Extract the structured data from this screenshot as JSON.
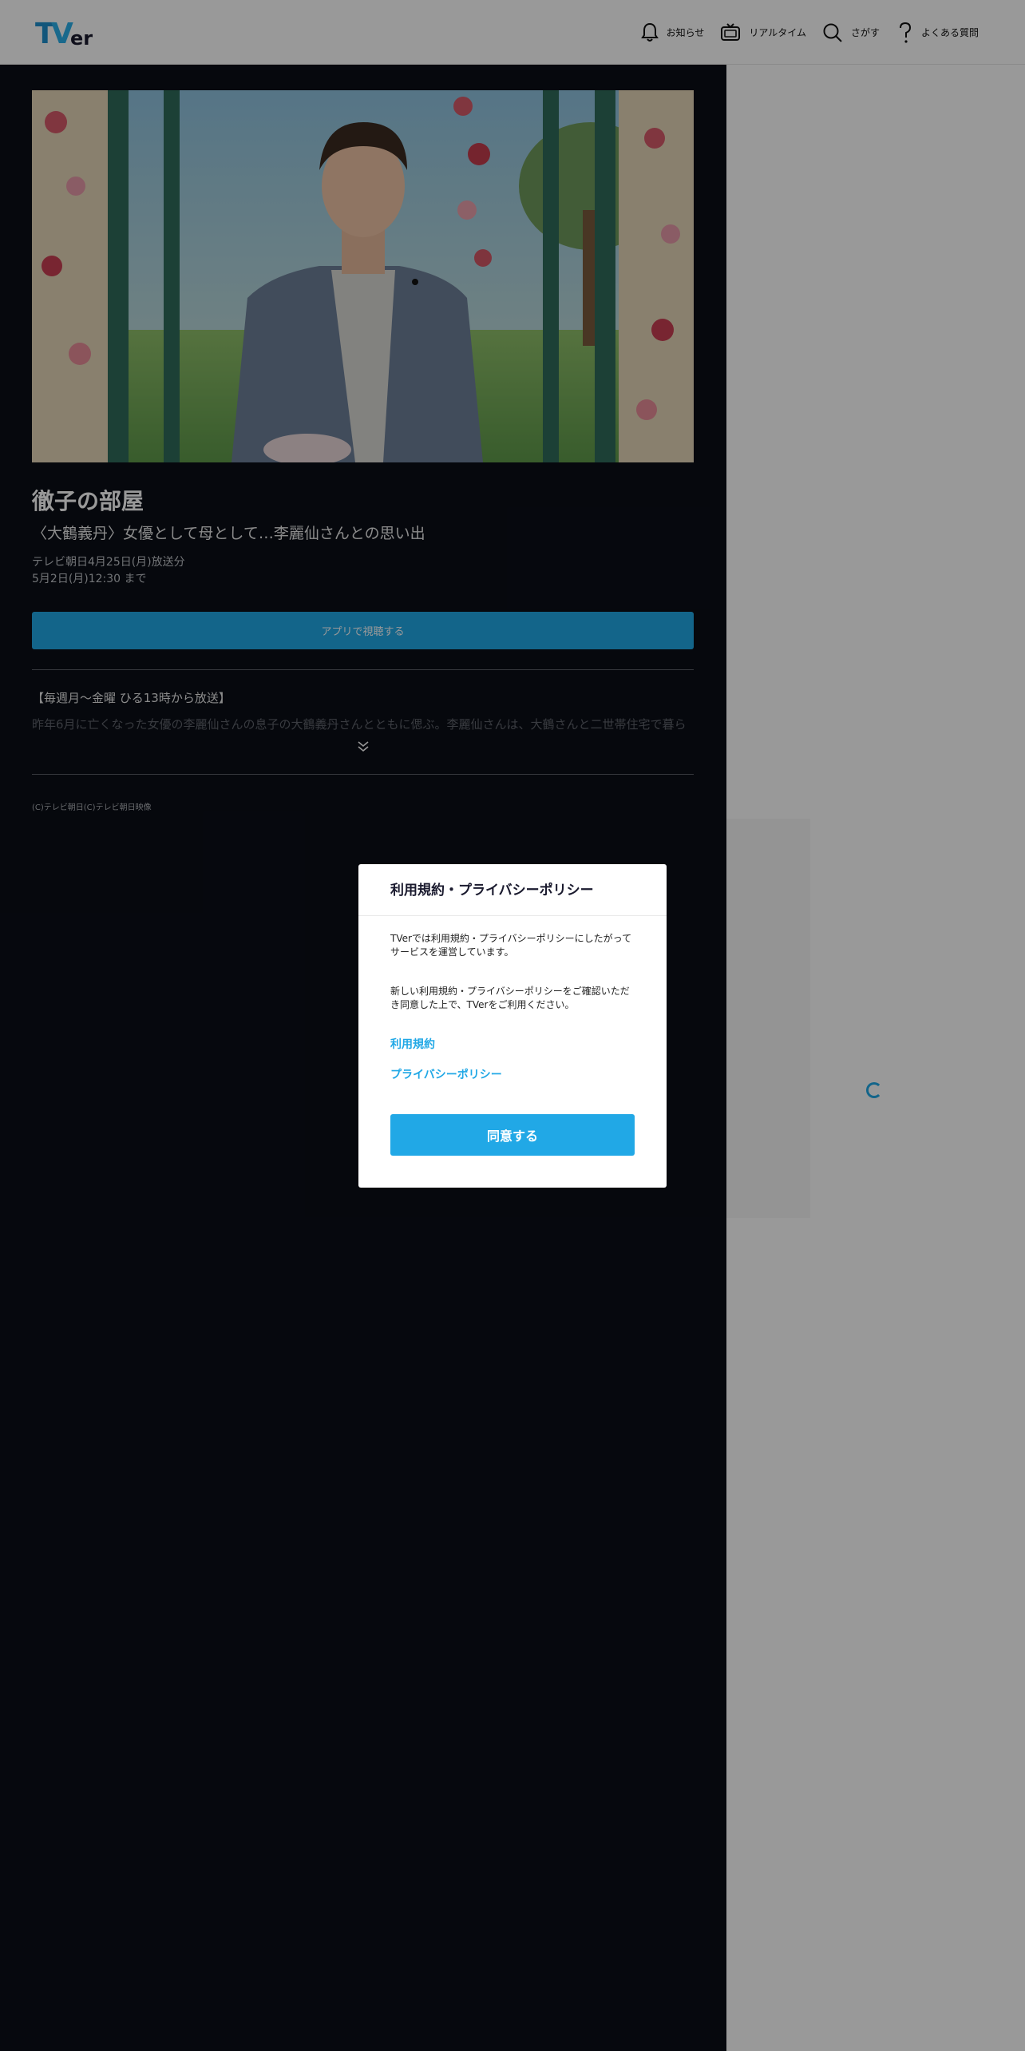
{
  "header": {
    "logo_text": "TVer",
    "nav": {
      "news_label": "お知らせ",
      "realtime_label": "リアルタイム",
      "search_label": "さがす",
      "faq_label": "よくある質問"
    }
  },
  "episode": {
    "series_title": "徹子の部屋",
    "episode_title": "〈大鶴義丹〉女優として母として…李麗仙さんとの思い出",
    "broadcast_info": "テレビ朝日4月25日(月)放送分",
    "availability": "5月2日(月)12:30 まで",
    "app_button_label": "アプリで視聴する",
    "description_line1": "【毎週月～金曜 ひる13時から放送】",
    "description_line2": "昨年6月に亡くなった女優の李麗仙さんの息子の大鶴義丹さんとともに偲ぶ。李麗仙さんは、大鶴さんと二世帯住宅で暮ら",
    "copyright": "(C)テレビ朝日(C)テレビ朝日映像"
  },
  "modal": {
    "title": "利用規約・プライバシーポリシー",
    "paragraph1": "TVerでは利用規約・プライバシーポリシーにしたがってサービスを運営しています。",
    "paragraph2": "新しい利用規約・プライバシーポリシーをご確認いただき同意した上で、TVerをご利用ください。",
    "terms_link": "利用規約",
    "privacy_link": "プライバシーポリシー",
    "agree_button": "同意する"
  },
  "colors": {
    "accent": "#21a8e6",
    "main_bg": "#0a0e17",
    "overlay": "rgba(0,0,0,0.4)"
  }
}
